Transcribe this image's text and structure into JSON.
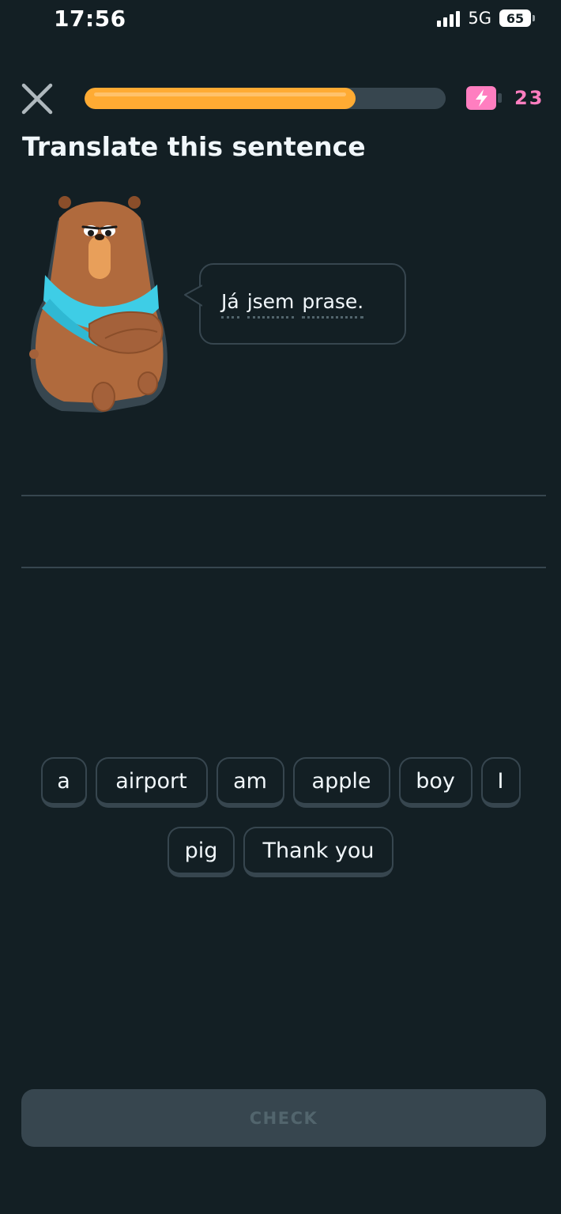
{
  "status_bar": {
    "time": "17:56",
    "network": "5G",
    "battery": "65"
  },
  "header": {
    "progress_fraction": 0.75,
    "energy_count": "23",
    "energy_color": "#ff7ec0",
    "progress_color": "#ffab33"
  },
  "prompt": {
    "title": "Translate this sentence",
    "sentence_words": [
      "Já",
      "jsem",
      "prase."
    ]
  },
  "word_bank": {
    "row1": [
      "a",
      "airport",
      "am",
      "apple",
      "boy",
      "I"
    ],
    "row2": [
      "pig",
      "Thank you"
    ]
  },
  "footer": {
    "check_label": "CHECK"
  },
  "icons": {
    "close": "close-icon",
    "energy": "energy-battery-icon",
    "character": "bear-character"
  }
}
